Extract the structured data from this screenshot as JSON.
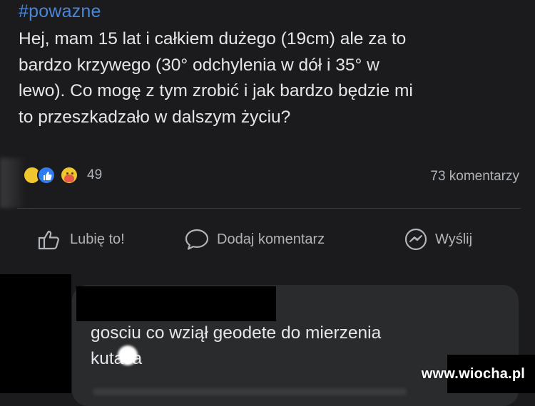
{
  "post": {
    "hashtag": "#powazne",
    "lines": [
      "Hej, mam 15 lat i całkiem dużego (19cm) ale za to",
      "bardzo krzywego (30° odchylenia w dół i 35° w",
      "lewo). Co mogę z tym zrobić i jak bardzo będzie mi",
      "to przeszkadzało w dalszym życiu?"
    ]
  },
  "reactions": {
    "icons": [
      "haha-icon",
      "like-icon",
      "care-icon"
    ],
    "count": "49",
    "comments_count": "73 komentarzy"
  },
  "actions": {
    "like_label": "Lubię to!",
    "comment_label": "Dodaj komentarz",
    "send_label": "Wyślij"
  },
  "comment": {
    "lines": [
      "gosciu co wziął geodete do mierzenia",
      "kutasa"
    ]
  },
  "watermark": "www.wiocha.pl",
  "colors": {
    "background": "#1b1b1d",
    "hashtag": "#4b86d6",
    "text": "#e4e6ea",
    "muted": "#b0b3b8",
    "bubble": "#2a2b2d"
  }
}
